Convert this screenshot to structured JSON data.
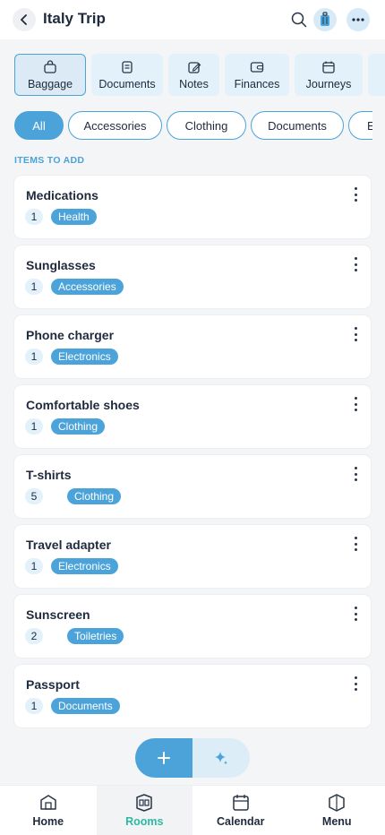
{
  "header": {
    "title": "Italy Trip",
    "icons": [
      "back-arrow-icon",
      "search-icon",
      "suitcase-icon",
      "more-icon"
    ]
  },
  "categories": [
    {
      "label": "Baggage",
      "icon": "bag-icon",
      "active": true
    },
    {
      "label": "Documents",
      "icon": "document-icon",
      "active": false
    },
    {
      "label": "Notes",
      "icon": "note-icon",
      "active": false
    },
    {
      "label": "Finances",
      "icon": "wallet-icon",
      "active": false
    },
    {
      "label": "Journeys",
      "icon": "calendar-icon",
      "active": false
    }
  ],
  "filters": [
    {
      "label": "All",
      "active": true
    },
    {
      "label": "Accessories",
      "active": false
    },
    {
      "label": "Clothing",
      "active": false
    },
    {
      "label": "Documents",
      "active": false
    },
    {
      "label": "El",
      "active": false
    }
  ],
  "section_label": "ITEMS TO ADD",
  "items": [
    {
      "name": "Medications",
      "qty": "1",
      "tag": "Health"
    },
    {
      "name": "Sunglasses",
      "qty": "1",
      "tag": "Accessories"
    },
    {
      "name": "Phone charger",
      "qty": "1",
      "tag": "Electronics"
    },
    {
      "name": "Comfortable shoes",
      "qty": "1",
      "tag": "Clothing"
    },
    {
      "name": "T-shirts",
      "qty": "5",
      "tag": "Clothing"
    },
    {
      "name": "Travel adapter",
      "qty": "1",
      "tag": "Electronics"
    },
    {
      "name": "Sunscreen",
      "qty": "2",
      "tag": "Toiletries"
    },
    {
      "name": "Passport",
      "qty": "1",
      "tag": "Documents"
    }
  ],
  "fab": {
    "add_icon": "plus-icon",
    "ai_icon": "sparkle-icon"
  },
  "nav": [
    {
      "label": "Home",
      "icon": "home-icon",
      "active": false
    },
    {
      "label": "Rooms",
      "icon": "rooms-icon",
      "active": true
    },
    {
      "label": "Calendar",
      "icon": "calendar-icon",
      "active": false
    },
    {
      "label": "Menu",
      "icon": "menu-icon",
      "active": false
    }
  ],
  "colors": {
    "accent": "#4ba3d9",
    "active_nav": "#2eb9a1",
    "text": "#1f2a3d"
  }
}
